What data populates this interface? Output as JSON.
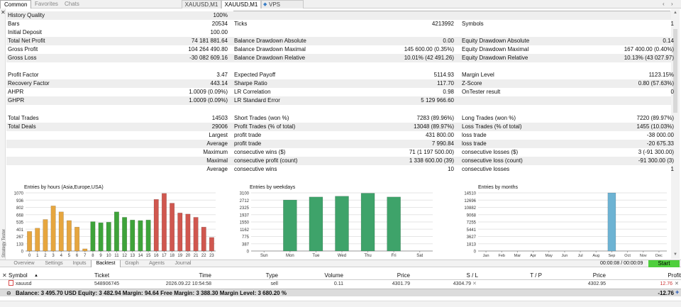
{
  "top_tabs": [
    "Common",
    "Favorites",
    "Chats"
  ],
  "doc_tabs": [
    "XAUUSD,M1",
    "XAUUSD,M1",
    "VPS"
  ],
  "sidebar_label": "Strategy Tester",
  "progress": {
    "fraction": 0.95
  },
  "stats": {
    "history_quality": [
      "History Quality",
      "100%"
    ],
    "bars": [
      "Bars",
      "20534"
    ],
    "ticks": [
      "Ticks",
      "4213992"
    ],
    "symbols": [
      "Symbols",
      "1"
    ],
    "initial_deposit": [
      "Initial Deposit",
      "100.00"
    ],
    "total_net_profit": [
      "Total Net Profit",
      "74 181 881.64"
    ],
    "bal_dd_abs": [
      "Balance Drawdown Absolute",
      "0.00"
    ],
    "eq_dd_abs": [
      "Equity Drawdown Absolute",
      "0.14"
    ],
    "gross_profit": [
      "Gross Profit",
      "104 264 490.80"
    ],
    "bal_dd_max": [
      "Balance Drawdown Maximal",
      "145 600.00 (0.35%)"
    ],
    "eq_dd_max": [
      "Equity Drawdown Maximal",
      "167 400.00 (0.40%)"
    ],
    "gross_loss": [
      "Gross Loss",
      "-30 082 609.16"
    ],
    "bal_dd_rel": [
      "Balance Drawdown Relative",
      "10.01% (42 491.26)"
    ],
    "eq_dd_rel": [
      "Equity Drawdown Relative",
      "10.13% (43 027.97)"
    ],
    "profit_factor": [
      "Profit Factor",
      "3.47"
    ],
    "expected_payoff": [
      "Expected Payoff",
      "5114.93"
    ],
    "margin_level": [
      "Margin Level",
      "1123.15%"
    ],
    "recovery_factor": [
      "Recovery Factor",
      "443.14"
    ],
    "sharpe_ratio": [
      "Sharpe Ratio",
      "117.70"
    ],
    "z_score": [
      "Z-Score",
      "0.80 (57.63%)"
    ],
    "ahpr": [
      "AHPR",
      "1.0009 (0.09%)"
    ],
    "lr_correlation": [
      "LR Correlation",
      "0.98"
    ],
    "ontester": [
      "OnTester result",
      "0"
    ],
    "ghpr": [
      "GHPR",
      "1.0009 (0.09%)"
    ],
    "lr_std_error": [
      "LR Standard Error",
      "5 129 966.60"
    ],
    "total_trades": [
      "Total Trades",
      "14503"
    ],
    "short_trades": [
      "Short Trades (won %)",
      "7283 (89.96%)"
    ],
    "long_trades": [
      "Long Trades (won %)",
      "7220 (89.97%)"
    ],
    "total_deals": [
      "Total Deals",
      "29006"
    ],
    "profit_trades": [
      "Profit Trades (% of total)",
      "13048 (89.97%)"
    ],
    "loss_trades": [
      "Loss Trades (% of total)",
      "1455 (10.03%)"
    ],
    "largest": [
      "Largest",
      "profit trade",
      "431 800.00",
      "loss trade",
      "-38 000.00"
    ],
    "average": [
      "Average",
      "profit trade",
      "7 990.84",
      "loss trade",
      "-20 675.33"
    ],
    "maximum": [
      "Maximum",
      "consecutive wins ($)",
      "71 (1 197 500.00)",
      "consecutive losses ($)",
      "3 (-91 300.00)"
    ],
    "maximal": [
      "Maximal",
      "consecutive profit (count)",
      "1 338 600.00 (39)",
      "consecutive loss (count)",
      "-91 300.00 (3)"
    ],
    "average2": [
      "Average",
      "consecutive wins",
      "10",
      "consecutive losses",
      "1"
    ]
  },
  "chart_data": [
    {
      "type": "bar",
      "title": "Entries by hours (Asia,Europe,USA)",
      "categories": [
        "0",
        "1",
        "2",
        "3",
        "4",
        "5",
        "6",
        "7",
        "8",
        "9",
        "10",
        "11",
        "12",
        "13",
        "14",
        "15",
        "16",
        "17",
        "18",
        "19",
        "20",
        "21",
        "22",
        "23"
      ],
      "values": [
        360,
        420,
        580,
        830,
        720,
        560,
        440,
        40,
        540,
        520,
        530,
        720,
        620,
        570,
        560,
        570,
        950,
        1060,
        880,
        700,
        680,
        620,
        440,
        250
      ],
      "colors": [
        "#e6a63f",
        "#e6a63f",
        "#e6a63f",
        "#e6a63f",
        "#e6a63f",
        "#e6a63f",
        "#e6a63f",
        "#e6a63f",
        "#3ea33a",
        "#3ea33a",
        "#3ea33a",
        "#3ea33a",
        "#3ea33a",
        "#3ea33a",
        "#3ea33a",
        "#3ea33a",
        "#d0574f",
        "#d0574f",
        "#d0574f",
        "#d0574f",
        "#d0574f",
        "#d0574f",
        "#d0574f",
        "#d0574f"
      ],
      "yticks": [
        "1070",
        "936",
        "802",
        "668",
        "535",
        "401",
        "267",
        "133",
        "0"
      ],
      "ylim": [
        0,
        1070
      ]
    },
    {
      "type": "bar",
      "title": "Entries by weekdays",
      "categories": [
        "Sun",
        "Mon",
        "Tue",
        "Wed",
        "Thu",
        "Fri",
        "Sat"
      ],
      "values": [
        0,
        2720,
        2880,
        2920,
        3080,
        2880,
        0
      ],
      "color": "#3ea36a",
      "yticks": [
        "3100",
        "2712",
        "2325",
        "1937",
        "1550",
        "1162",
        "775",
        "387",
        "0"
      ],
      "ylim": [
        0,
        3100
      ]
    },
    {
      "type": "bar",
      "title": "Entries by months",
      "categories": [
        "Jan",
        "Feb",
        "Mar",
        "Apr",
        "May",
        "Jun",
        "Jul",
        "Aug",
        "Sep",
        "Oct",
        "Nov",
        "Dec"
      ],
      "values": [
        0,
        0,
        0,
        0,
        0,
        0,
        0,
        0,
        14503,
        0,
        0,
        0
      ],
      "color": "#6db3d3",
      "yticks": [
        "14510",
        "12696",
        "10882",
        "9068",
        "7255",
        "5441",
        "3627",
        "1813",
        "0"
      ],
      "ylim": [
        0,
        14510
      ]
    }
  ],
  "bottom_tabs": [
    "Overview",
    "Settings",
    "Inputs",
    "Backtest",
    "Graph",
    "Agents",
    "Journal"
  ],
  "time_readout": "00:00:08 / 00:00:09",
  "start_label": "Start",
  "table": {
    "headers": [
      "Symbol",
      "Ticket",
      "Time",
      "Type",
      "Volume",
      "Price",
      "S / L",
      "T / P",
      "Price",
      "Profit"
    ],
    "row": [
      "xauusd",
      "548906745",
      "2026.09.22 10:54:58",
      "sell",
      "0.11",
      "4301.79",
      "4304.79",
      "",
      "4302.95",
      "12.76"
    ]
  },
  "status": {
    "text": "Balance: 3 495.70 USD  Equity: 3 482.94  Margin: 94.64  Free Margin: 3 388.30  Margin Level: 3 680.20 %",
    "value": "-12.76"
  }
}
